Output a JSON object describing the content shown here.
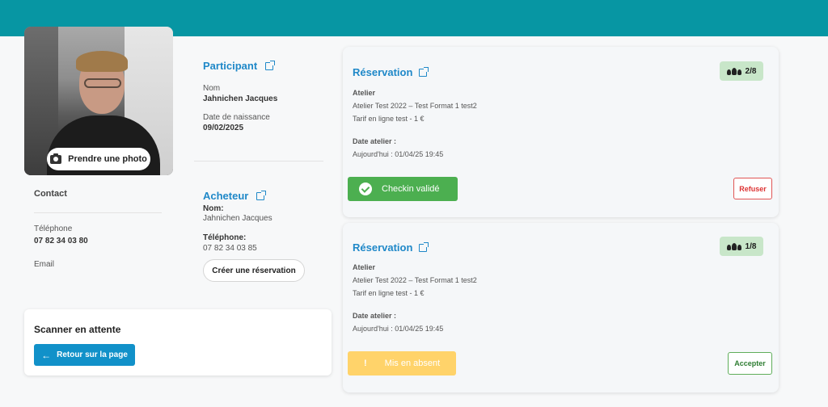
{
  "colors": {
    "topbar": "#0796a3",
    "link": "#1f88c8",
    "success": "#4caf50",
    "warning": "#ffd36a",
    "danger": "#e05555",
    "badge": "#c8e6c9"
  },
  "photo": {
    "button_label": "Prendre une photo",
    "icon": "camera-icon"
  },
  "contact": {
    "title": "Contact",
    "phone_label": "Téléphone",
    "phone_value": "07 82 34 03 80",
    "email_label": "Email"
  },
  "participant": {
    "title": "Participant",
    "nom_label": "Nom",
    "nom_value": "Jahnichen Jacques",
    "dob_label": "Date de naissance",
    "dob_value": "09/02/2025"
  },
  "acheteur": {
    "title": "Acheteur",
    "nom_label": "Nom:",
    "nom_value": "Jahnichen Jacques",
    "phone_label": "Téléphone:",
    "phone_value": "07 82 34 03 85",
    "create_label": "Créer une réservation"
  },
  "scanner": {
    "title": "Scanner en attente",
    "back_label": "Retour sur la page"
  },
  "reservations": [
    {
      "title": "Réservation",
      "count": "2/8",
      "atelier_label": "Atelier",
      "atelier_name": "Atelier Test 2022 – Test Format 1 test2",
      "tarif": "Tarif en ligne test - 1 €",
      "date_label": "Date atelier :",
      "date_value": "Aujourd'hui : 01/04/25 19:45",
      "status_label": "Checkin validé",
      "action_label": "Refuser"
    },
    {
      "title": "Réservation",
      "count": "1/8",
      "atelier_label": "Atelier",
      "atelier_name": "Atelier Test 2022 – Test Format 1 test2",
      "tarif": "Tarif en ligne test - 1 €",
      "date_label": "Date atelier :",
      "date_value": "Aujourd'hui : 01/04/25 19:45",
      "status_label": "Mis en absent",
      "status_icon": "!",
      "action_label": "Accepter"
    }
  ]
}
